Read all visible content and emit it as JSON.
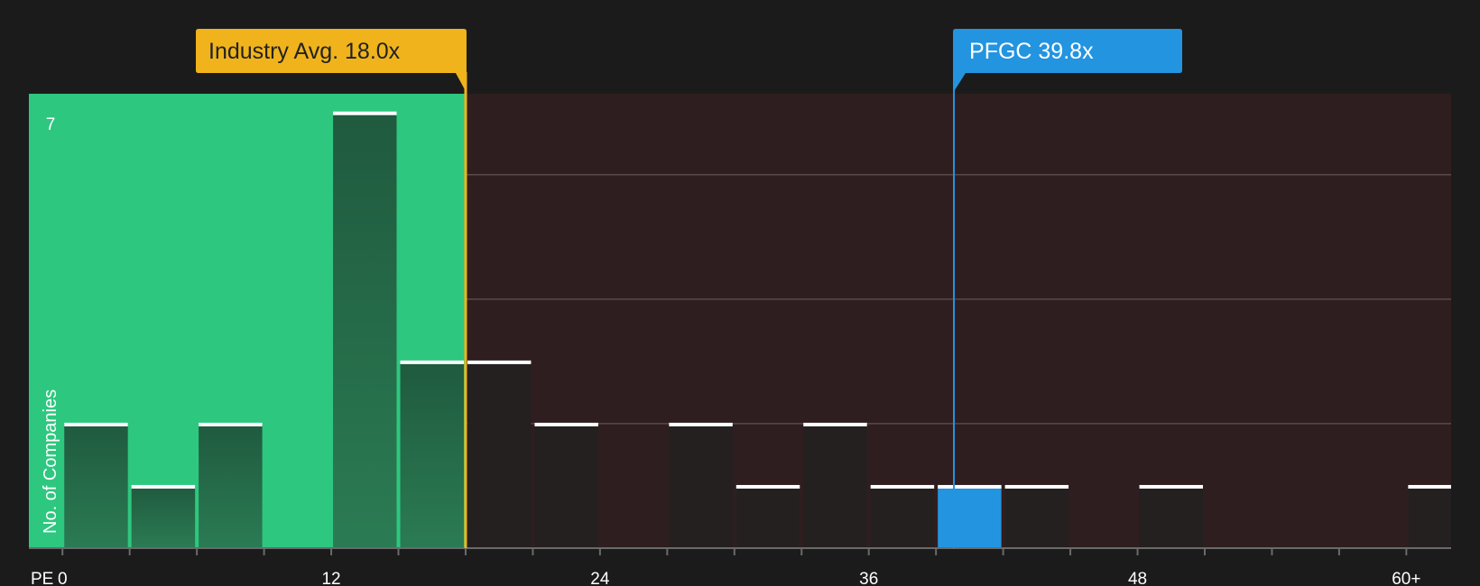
{
  "chart_data": {
    "type": "bar",
    "title": "",
    "xlabel": "PE",
    "ylabel": "No. of Companies",
    "xlim": [
      -1.5,
      62
    ],
    "ylim": [
      0,
      7.3
    ],
    "y_tick_labels": [
      {
        "value": 7,
        "label": "7"
      }
    ],
    "gridlines_y": [
      2,
      4,
      6,
      8
    ],
    "x_tick_labels": [
      {
        "value": 0,
        "label": "0"
      },
      {
        "value": 12,
        "label": "12"
      },
      {
        "value": 24,
        "label": "24"
      },
      {
        "value": 36,
        "label": "36"
      },
      {
        "value": 48,
        "label": "48"
      },
      {
        "value": 60,
        "label": "60+"
      }
    ],
    "x_minor_ticks": [
      0,
      3,
      6,
      9,
      12,
      15,
      18,
      21,
      24,
      27,
      30,
      33,
      36,
      39,
      42,
      45,
      48,
      51,
      54,
      57,
      60
    ],
    "bins": [
      {
        "start": 0,
        "end": 3,
        "count": 2
      },
      {
        "start": 3,
        "end": 6,
        "count": 1
      },
      {
        "start": 6,
        "end": 9,
        "count": 2
      },
      {
        "start": 9,
        "end": 12,
        "count": 0
      },
      {
        "start": 12,
        "end": 15,
        "count": 7
      },
      {
        "start": 15,
        "end": 18,
        "count": 3
      },
      {
        "start": 18,
        "end": 21,
        "count": 3
      },
      {
        "start": 21,
        "end": 24,
        "count": 2
      },
      {
        "start": 24,
        "end": 27,
        "count": 0
      },
      {
        "start": 27,
        "end": 30,
        "count": 2
      },
      {
        "start": 30,
        "end": 33,
        "count": 1
      },
      {
        "start": 33,
        "end": 36,
        "count": 2
      },
      {
        "start": 36,
        "end": 39,
        "count": 1
      },
      {
        "start": 39,
        "end": 42,
        "count": 1,
        "highlight": true
      },
      {
        "start": 42,
        "end": 45,
        "count": 1
      },
      {
        "start": 45,
        "end": 48,
        "count": 0
      },
      {
        "start": 48,
        "end": 51,
        "count": 1
      },
      {
        "start": 51,
        "end": 54,
        "count": 0
      },
      {
        "start": 54,
        "end": 57,
        "count": 0
      },
      {
        "start": 57,
        "end": 60,
        "count": 0
      },
      {
        "start": 60,
        "end": 63,
        "count": 1
      }
    ],
    "industry_avg": {
      "value": 18.0,
      "label": "Industry Avg. 18.0x"
    },
    "company": {
      "ticker": "PFGC",
      "value": 39.8,
      "label": "PFGC 39.8x"
    },
    "grid": true,
    "legend": "none"
  },
  "colors": {
    "background": "#1b1b1b",
    "below_avg_zone": "#2ec77f",
    "above_avg_zone": "#2f1e1f",
    "bar_green_zone": "#1f5a40",
    "bar_dark_zone": "#252020",
    "bar_highlight": "#2394e0",
    "bar_cap": "#ffffff",
    "industry_avg": "#f0b31c",
    "company": "#2394e0",
    "gridline": "#5a4a4a",
    "axis": "#6a6a6a"
  }
}
